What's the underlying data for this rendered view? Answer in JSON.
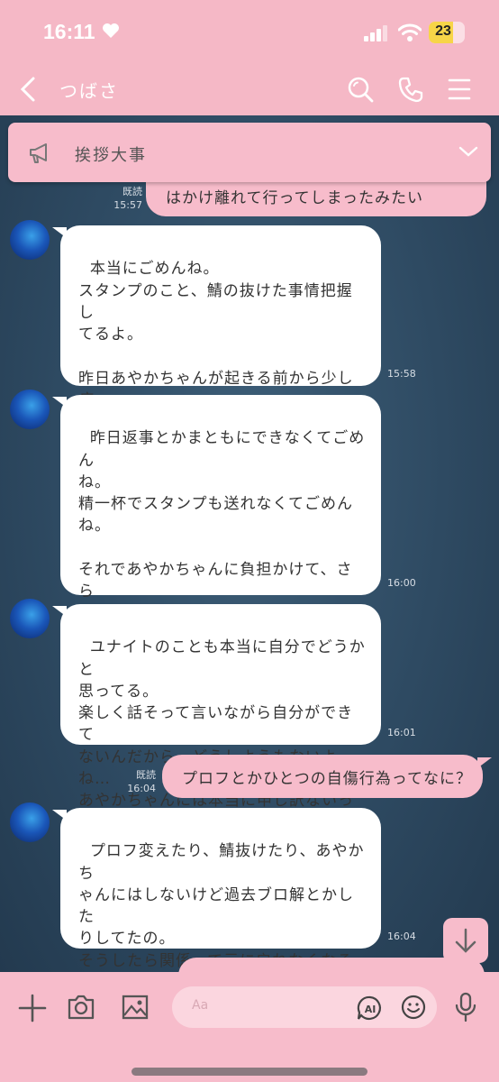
{
  "status_bar": {
    "time": "16:11",
    "battery": "23"
  },
  "header": {
    "title": "つばさ"
  },
  "announcement": {
    "text": "挨拶大事"
  },
  "messages": [
    {
      "side": "right",
      "read": "既読",
      "time": "15:57",
      "text": "はかけ離れて行ってしまったみたい"
    },
    {
      "side": "left",
      "time": "15:58",
      "text": "本当にごめんね。\nスタンプのこと、鯖の抜けた事情把握し\nてるよ。\n\n昨日あやかちゃんが起きる前から少し病\nみ気味なってて、あやかちゃんの影響と\nかは一切なかったの。"
    },
    {
      "side": "left",
      "time": "16:00",
      "text": "昨日返事とかまともにできなくてごめん\nね。\n精一杯でスタンプも送れなくてごめん\nね。\n\nそれであやかちゃんに負担かけて、さら\nに負担かけてしまった罪悪感に悪化し\nて、あげくプロフとかひとつの自傷行為\nしてた。"
    },
    {
      "side": "left",
      "time": "16:01",
      "text": "ユナイトのことも本当に自分でどうかと\n思ってる。\n楽しく話そって言いながら自分ができて\nないんだから、どうしようもないよね…\nあやかちゃんには本当に申し訳ないって\n思ってる…"
    },
    {
      "side": "right",
      "read": "既読",
      "time": "16:04",
      "text": "プロフとかひとつの自傷行為ってなに？"
    },
    {
      "side": "left",
      "time": "16:04",
      "text": "プロフ変えたり、鯖抜けたり、あやかち\nゃんにはしないけど過去ブロ解とかした\nりしてたの。\nそうしたら関係って元に戻れなくなるか\nら、そうやって自分を傷つけてた。\nもちろん相手にも…"
    }
  ],
  "input": {
    "placeholder": "Aa"
  },
  "icons": [
    "back-icon",
    "search-icon",
    "phone-icon",
    "menu-icon",
    "megaphone-icon",
    "chevron-down-icon",
    "arrow-down-icon",
    "plus-icon",
    "camera-icon",
    "image-icon",
    "ai-icon",
    "emoji-icon",
    "mic-icon"
  ],
  "colors": {
    "header_pink": "#f5b8c6",
    "bubble_pink": "#f7bccb",
    "chat_bg": "#2f4d66"
  }
}
